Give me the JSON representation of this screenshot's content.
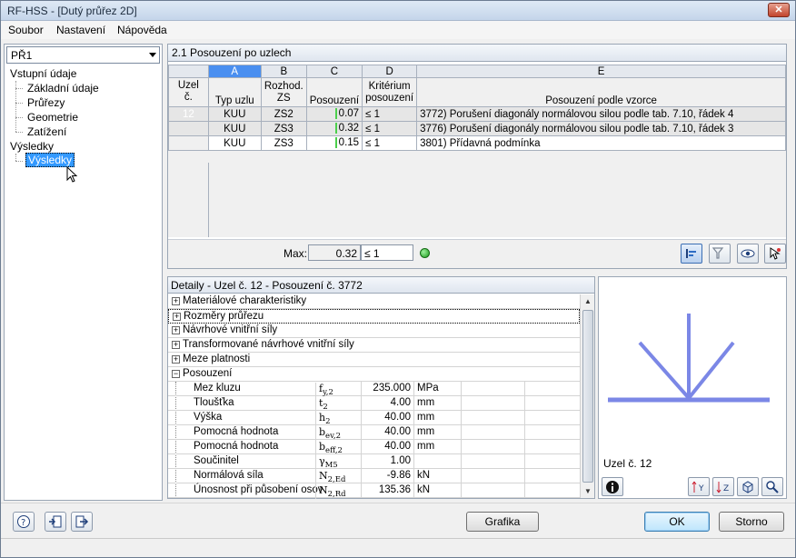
{
  "window": {
    "title": "RF-HSS - [Dutý průřez 2D]",
    "close_glyph": "✕"
  },
  "menu": [
    {
      "label": "Soubor"
    },
    {
      "label": "Nastavení"
    },
    {
      "label": "Nápověda"
    }
  ],
  "navigator": {
    "case_selected": "PŘ1",
    "input_heading": "Vstupní údaje",
    "input_items": [
      "Základní údaje",
      "Průřezy",
      "Geometrie",
      "Zatížení"
    ],
    "results_heading": "Výsledky",
    "results_items": [
      "Výsledky"
    ]
  },
  "table": {
    "title": "2.1 Posouzení po uzlech",
    "letters": [
      "A",
      "B",
      "C",
      "D",
      "E"
    ],
    "header_node_line1": "Uzel",
    "header_node_line2": "č.",
    "headers": {
      "a": "Typ uzlu",
      "b_line1": "Rozhod.",
      "b_line2": "ZS",
      "c": "Posouzení",
      "d_line1": "Kritérium",
      "d_line2": "posouzení",
      "e": "Posouzení podle vzorce"
    },
    "rows": [
      {
        "node": "12",
        "type": "KUU",
        "lc": "ZS2",
        "ratio": "0.07",
        "criterion": "≤ 1",
        "formula": "3772) Porušení diagonály normálovou silou podle tab. 7.10, řádek 4"
      },
      {
        "node": "",
        "type": "KUU",
        "lc": "ZS3",
        "ratio": "0.32",
        "criterion": "≤ 1",
        "formula": "3776) Porušení diagonály normálovou silou podle tab. 7.10, řádek 3"
      },
      {
        "node": "",
        "type": "KUU",
        "lc": "ZS3",
        "ratio": "0.15",
        "criterion": "≤ 1",
        "formula": "3801) Přídavná podmínka"
      }
    ],
    "max_label": "Max:",
    "max_value": "0.32",
    "max_criterion": "≤ 1"
  },
  "details": {
    "title": "Detaily - Uzel č. 12 - Posouzení č. 3772",
    "sections": [
      {
        "label": "Materiálové charakteristiky",
        "expander": "+"
      },
      {
        "label": "Rozměry průřezu",
        "expander": "+"
      },
      {
        "label": "Návrhové vnitřní síly",
        "expander": "+"
      },
      {
        "label": "Transformované návrhové vnitřní síly",
        "expander": "+"
      },
      {
        "label": "Meze platnosti",
        "expander": "+"
      },
      {
        "label": "Posouzení",
        "expander": "−"
      }
    ],
    "rows": [
      {
        "label": "Mez kluzu",
        "sym": "f",
        "sub": "y,2",
        "value": "235.000",
        "unit": "MPa"
      },
      {
        "label": "Tloušťka",
        "sym": "t",
        "sub": "2",
        "value": "4.00",
        "unit": "mm"
      },
      {
        "label": "Výška",
        "sym": "h",
        "sub": "2",
        "value": "40.00",
        "unit": "mm"
      },
      {
        "label": "Pomocná hodnota",
        "sym": "b",
        "sub": "ev,2",
        "value": "40.00",
        "unit": "mm"
      },
      {
        "label": "Pomocná hodnota",
        "sym": "b",
        "sub": "eff,2",
        "value": "40.00",
        "unit": "mm"
      },
      {
        "label": "Součinitel",
        "sym": "γ",
        "sub": "M5",
        "value": "1.00",
        "unit": ""
      },
      {
        "label": "Normálová síla",
        "sym": "N",
        "sub": "2,Ed",
        "value": "-9.86",
        "unit": "kN"
      },
      {
        "label": "Únosnost při působení osov",
        "sym": "N",
        "sub": "2,Rd",
        "value": "135.36",
        "unit": "kN"
      }
    ]
  },
  "graphic": {
    "caption": "Uzel č. 12"
  },
  "buttons": {
    "graphics": "Grafika",
    "ok": "OK",
    "cancel": "Storno"
  },
  "colors": {
    "accent": "#4a8ff0",
    "member": "#7b87e6"
  }
}
